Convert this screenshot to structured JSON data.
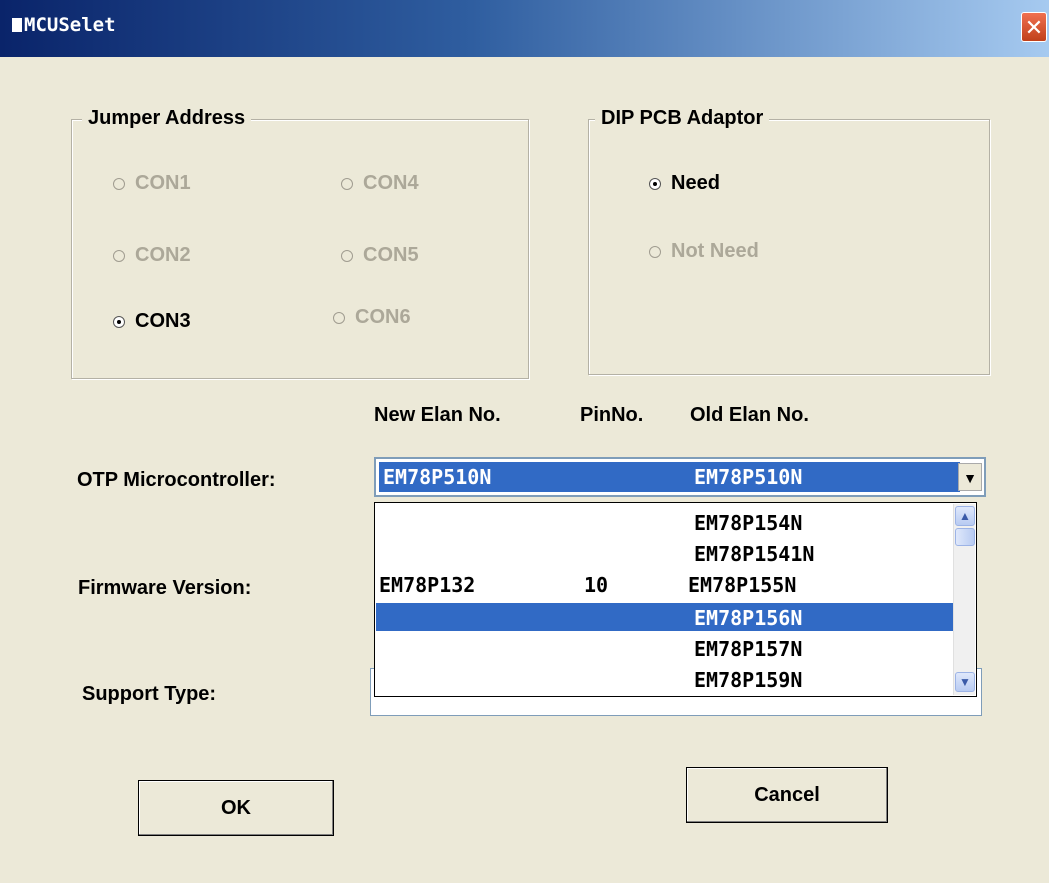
{
  "window": {
    "title": "MCUSelet"
  },
  "jumper_address": {
    "legend": "Jumper Address",
    "options": [
      "CON1",
      "CON4",
      "CON2",
      "CON5",
      "CON3",
      "CON6"
    ]
  },
  "dip_pcb": {
    "legend": "DIP PCB Adaptor",
    "options": [
      "Need",
      "Not Need"
    ]
  },
  "columns": {
    "new_elan": "New Elan No.",
    "pin_no": "PinNo.",
    "old_elan": "Old Elan No."
  },
  "otp": {
    "label": "OTP Microcontroller:",
    "selected_new": "EM78P510N",
    "selected_old": "EM78P510N"
  },
  "dropdown_items": [
    {
      "new": "",
      "pin": "",
      "old": "EM78P154N"
    },
    {
      "new": "",
      "pin": "",
      "old": "EM78P1541N"
    },
    {
      "new": "EM78P132",
      "pin": "10",
      "old": "EM78P155N"
    },
    {
      "new": "",
      "pin": "",
      "old": "EM78P156N"
    },
    {
      "new": "",
      "pin": "",
      "old": "EM78P157N"
    },
    {
      "new": "",
      "pin": "",
      "old": "EM78P159N"
    }
  ],
  "firmware": {
    "label": "Firmware Version:"
  },
  "support": {
    "label": "Support Type:"
  },
  "buttons": {
    "ok": "OK",
    "cancel": "Cancel"
  },
  "icons": {
    "close": "close-icon",
    "scroll_up": "scroll-up-icon",
    "scroll_down": "scroll-down-icon",
    "combo_arrow": "chevron-down-icon"
  }
}
